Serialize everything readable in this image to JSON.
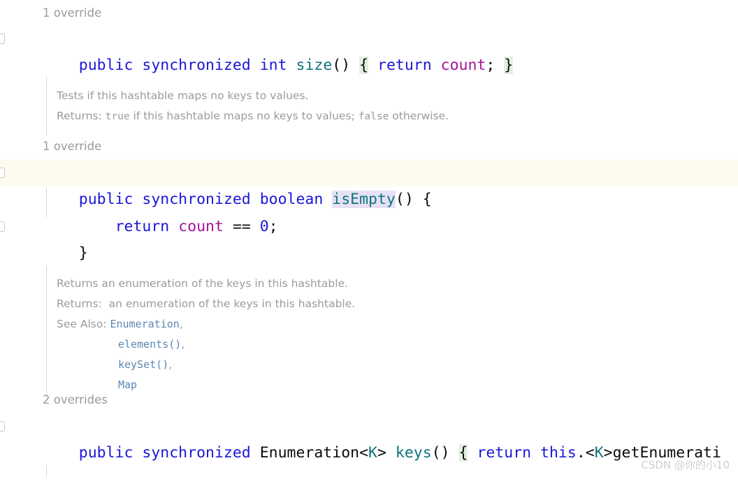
{
  "editor": {
    "background": "#ffffff",
    "caret_line_background": "#fdfaf0",
    "brace_highlight_background": "#e3f0e0",
    "identifier_highlight_background": "#e6e1f5",
    "keyword_color": "#1a16d6",
    "method_color": "#10737d",
    "field_color": "#a0159b",
    "doc_text_color": "#9b9b9b",
    "doc_link_color": "#5c87b2",
    "inlay_hint_color": "#9a9a9a"
  },
  "inlay_hints": {
    "size_override": "1 override",
    "isempty_override": "1 override",
    "keys_overrides": "2 overrides"
  },
  "code": {
    "size_method": {
      "t1": "public",
      "t2": " ",
      "t3": "synchronized",
      "t4": " ",
      "t5": "int",
      "t6": " ",
      "t7": "size",
      "t8": "()",
      "t9": " ",
      "t10": "{",
      "t11": " ",
      "t12": "return",
      "t13": " ",
      "t14": "count",
      "t15": ";",
      "t16": " ",
      "t17": "}"
    },
    "isempty_signature": {
      "t1": "public",
      "t2": " ",
      "t3": "synchronized",
      "t4": " ",
      "t5": "boolean",
      "t6": " ",
      "t7": "isEmpty",
      "t8": "() {"
    },
    "isempty_body": {
      "t1": "    ",
      "t2": "return",
      "t3": " ",
      "t4": "count",
      "t5": " == ",
      "t6": "0",
      "t7": ";"
    },
    "isempty_close": {
      "t1": "}"
    },
    "keys_method": {
      "t1": "public",
      "t2": " ",
      "t3": "synchronized",
      "t4": " ",
      "t5": "Enumeration<",
      "t6": "K",
      "t7": "> ",
      "t8": "keys",
      "t9": "()",
      "t10": " ",
      "t11": "{",
      "t12": " ",
      "t13": "return",
      "t14": " ",
      "t15": "this",
      "t16": ".<",
      "t17": "K",
      "t18": ">getEnumerati"
    }
  },
  "doc_isempty": {
    "summary": "Tests if this hashtable maps no keys to values.",
    "returns_label": "Returns:",
    "returns_pre": " ",
    "returns_true": "true",
    "returns_mid": " if this hashtable maps no keys to values; ",
    "returns_false": "false",
    "returns_post": " otherwise."
  },
  "doc_keys": {
    "summary": "Returns an enumeration of the keys in this hashtable.",
    "returns_label": "Returns:",
    "returns_value": "  an enumeration of the keys in this hashtable.",
    "see_also_label": "See Also:",
    "links": [
      {
        "text": "Enumeration",
        "comma": ","
      },
      {
        "text": "elements()",
        "comma": ","
      },
      {
        "text": "keySet()",
        "comma": ","
      },
      {
        "text": "Map",
        "comma": ""
      }
    ]
  },
  "watermark": {
    "text": "CSDN @你的小10"
  }
}
